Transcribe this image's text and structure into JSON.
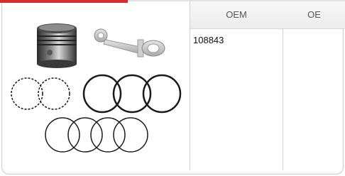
{
  "table": {
    "columns": [
      {
        "label": "OEM"
      },
      {
        "label": "OE"
      }
    ],
    "rows": [
      {
        "oem": "108843",
        "oe": ""
      }
    ]
  },
  "product_image": {
    "items": [
      "piston-icon",
      "connecting-rod-icon",
      "piston-ring-set-icon"
    ]
  },
  "colors": {
    "accent": "#d92b2b",
    "header_bg": "#efefef",
    "border": "#d0d0d0"
  }
}
